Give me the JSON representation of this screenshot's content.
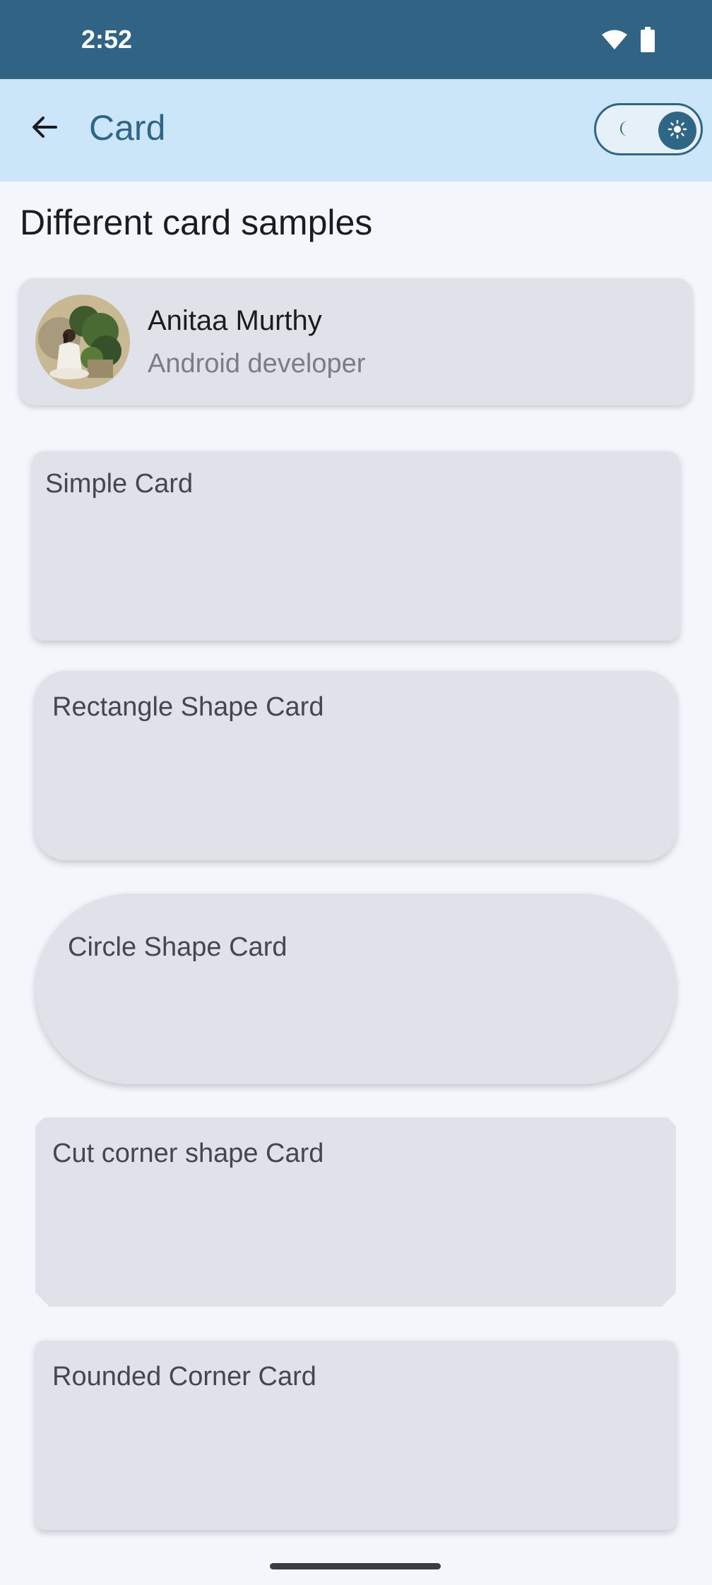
{
  "status": {
    "time": "2:52"
  },
  "app_bar": {
    "title": "Card"
  },
  "page": {
    "heading": "Different card samples"
  },
  "profile": {
    "name": "Anitaa Murthy",
    "role": "Android developer"
  },
  "cards": {
    "simple": "Simple Card",
    "rectangle": "Rectangle Shape Card",
    "circle": "Circle Shape Card",
    "cut_corner": "Cut corner shape Card",
    "rounded": "Rounded Corner Card"
  },
  "icons": {
    "back": "arrow-back-icon",
    "wifi": "wifi-icon",
    "battery": "battery-icon",
    "moon": "moon-icon",
    "sun": "sun-icon"
  },
  "colors": {
    "status_bar": "#316384",
    "app_bar": "#cbe5f9",
    "accent": "#2f6585",
    "card": "#dfe2e8",
    "background": "#f3f7fc"
  }
}
